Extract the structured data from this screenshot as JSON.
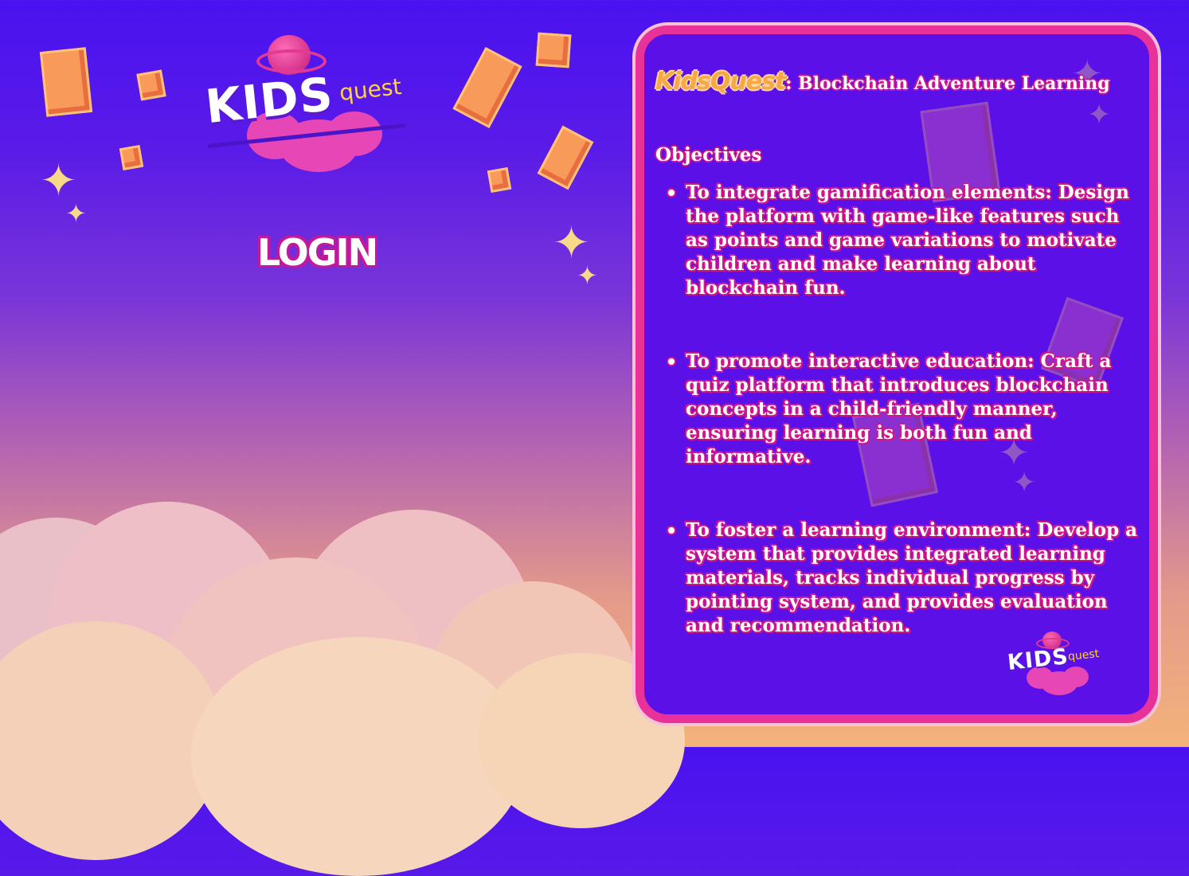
{
  "logo": {
    "kids": "KIDS",
    "quest": "quest"
  },
  "login_label": "LOGIN",
  "card": {
    "brand": "KidsQuest",
    "title_rest": ": Blockchain Adventure Learning",
    "section_heading": "Objectives",
    "objectives": [
      "To integrate gamification elements: Design the platform with game-like features such as points and game variations to motivate children and make learning about blockchain fun.",
      "To promote interactive education: Craft a quiz platform that introduces blockchain concepts in a child-friendly manner, ensuring learning is both fun and informative.",
      "To foster a learning environment: Develop a system that provides integrated learning materials, tracks individual progress by pointing system, and provides evaluation and recommendation."
    ]
  },
  "colors": {
    "sky_top": "#4a12f0",
    "sky_bottom": "#f4b37a",
    "card_bg": "#5a10e6",
    "card_border": "#e8329a",
    "brand_orange": "#f7a744",
    "gem": "#f79a5a",
    "sparkle": "#f8d98a"
  },
  "icons": [
    "planet-icon",
    "gem-icon",
    "sparkle-icon",
    "cloud-icon"
  ]
}
